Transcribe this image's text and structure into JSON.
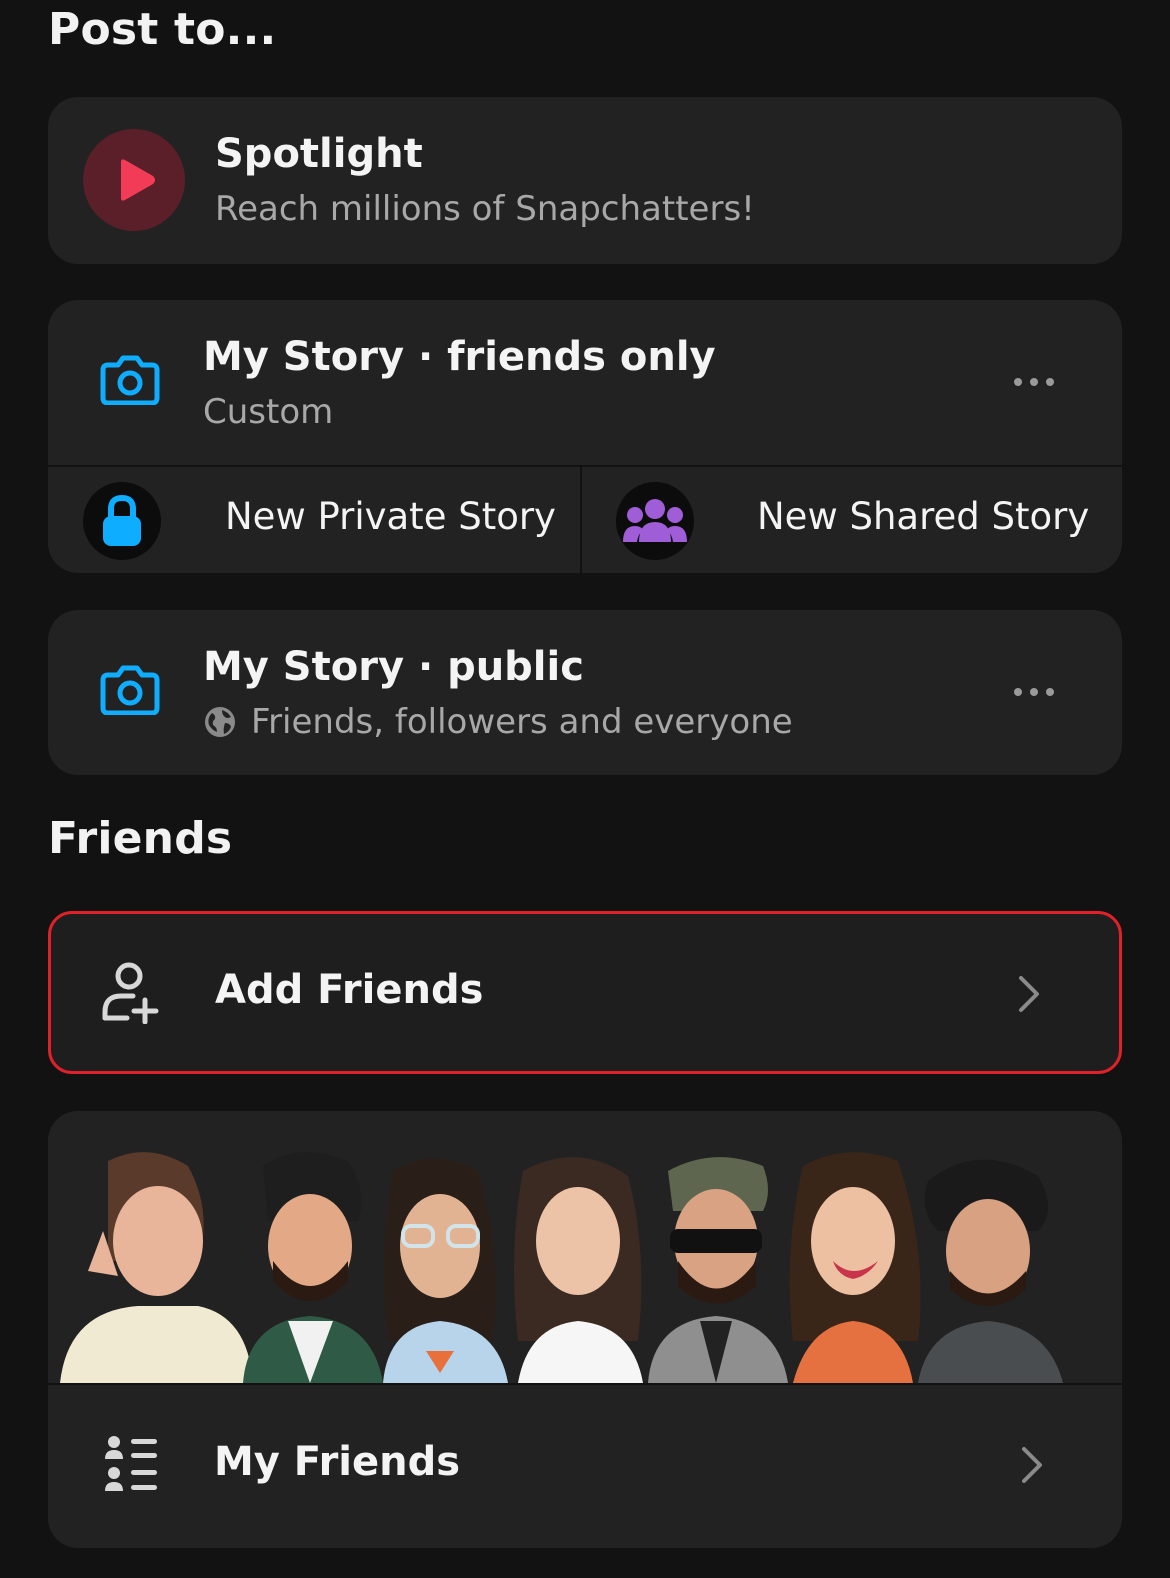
{
  "post_to_title": "Post to...",
  "spotlight": {
    "title": "Spotlight",
    "subtitle": "Reach millions of Snapchatters!",
    "icon": "spotlight-play-icon",
    "icon_color": "#f23c57",
    "icon_bg": "#5a1f28"
  },
  "my_story_friends": {
    "title": "My Story · friends only",
    "subtitle": "Custom",
    "icon": "camera-icon",
    "icon_color": "#0fadff"
  },
  "new_private_story": {
    "label": "New Private Story",
    "icon": "lock-icon",
    "icon_color": "#0fadff"
  },
  "new_shared_story": {
    "label": "New Shared Story",
    "icon": "group-icon",
    "icon_color": "#a05dd8"
  },
  "my_story_public": {
    "title": "My Story · public",
    "subtitle": "Friends, followers and everyone",
    "icon": "camera-icon",
    "subtitle_icon": "globe-icon"
  },
  "friends_title": "Friends",
  "add_friends": {
    "label": "Add Friends",
    "icon": "add-friend-icon",
    "highlight_color": "#e0212a"
  },
  "my_friends": {
    "label": "My Friends",
    "icon": "friends-list-icon"
  }
}
